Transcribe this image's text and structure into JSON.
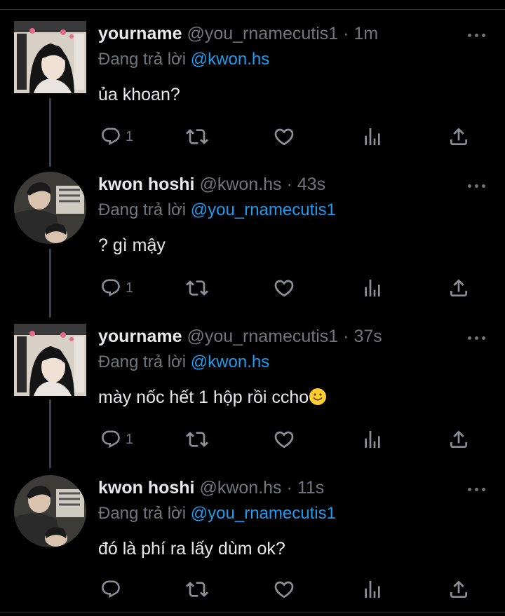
{
  "tweets": [
    {
      "name": "yourname",
      "handle": "@you_rnamecutis1",
      "dot": "·",
      "time": "1m",
      "replying_prefix": "Đang trả lời",
      "replying_to": "@kwon.hs",
      "text": "ủa khoan?",
      "reply_count": "1",
      "avatar_kind": "girl-photo-avatar"
    },
    {
      "name": "kwon hoshi",
      "handle": "@kwon.hs",
      "dot": "·",
      "time": "43s",
      "replying_prefix": "Đang trả lời",
      "replying_to": "@you_rnamecutis1",
      "text": "? gì mậy",
      "reply_count": "1",
      "avatar_kind": "boy-photo-avatar"
    },
    {
      "name": "yourname",
      "handle": "@you_rnamecutis1",
      "dot": "·",
      "time": "37s",
      "replying_prefix": "Đang trả lời",
      "replying_to": "@kwon.hs",
      "text": "mày nốc hết 1 hộp rồi ccho",
      "emoji": "slightly-smiling-face-emoji",
      "reply_count": "1",
      "avatar_kind": "girl-photo-avatar"
    },
    {
      "name": "kwon hoshi",
      "handle": "@kwon.hs",
      "dot": "·",
      "time": "11s",
      "replying_prefix": "Đang trả lời",
      "replying_to": "@you_rnamecutis1",
      "text": "đó là phí ra lấy dùm ok?",
      "reply_count": "",
      "avatar_kind": "boy-photo-avatar"
    }
  ],
  "icons": {
    "reply": "reply-icon",
    "retweet": "retweet-icon",
    "like": "like-icon",
    "views": "analytics-icon",
    "share": "share-icon",
    "more": "more-icon"
  },
  "colors": {
    "background": "#000000",
    "text": "#e7e9ea",
    "secondary": "#71767b",
    "link": "#1d9bf0",
    "thread_line": "#3e4144"
  }
}
